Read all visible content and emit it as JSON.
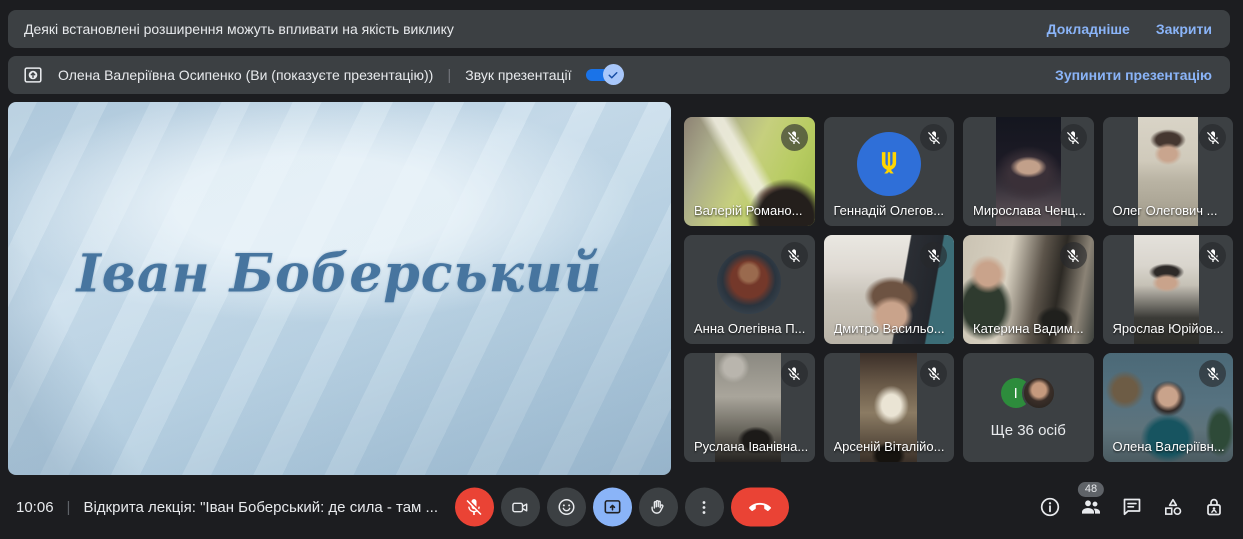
{
  "banner_extensions": {
    "message": "Деякі встановлені розширення можуть впливати на якість виклику",
    "details_label": "Докладніше",
    "close_label": "Закрити"
  },
  "banner_presentation": {
    "presenter": "Олена Валеріївна Осипенко (Ви (показуєте презентацію))",
    "sound_label": "Звук презентації",
    "sound_on": true,
    "stop_label": "Зупинити презентацію"
  },
  "presentation": {
    "slide_text": "Іван Боберський"
  },
  "participants": [
    {
      "name": "Валерій Романо...",
      "muted": true
    },
    {
      "name": "Геннадій Олегов...",
      "muted": true
    },
    {
      "name": "Мирослава Ченц...",
      "muted": true
    },
    {
      "name": "Олег Олегович ...",
      "muted": true
    },
    {
      "name": "Анна Олегівна П...",
      "muted": true
    },
    {
      "name": "Дмитро Васильо...",
      "muted": true
    },
    {
      "name": "Катерина Вадим...",
      "muted": true
    },
    {
      "name": "Ярослав Юрійов...",
      "muted": true
    },
    {
      "name": "Руслана Іванівна...",
      "muted": true
    },
    {
      "name": "Арсеній Віталійо...",
      "muted": true
    },
    {
      "name": "Ще 36 осіб",
      "overflow": true,
      "overflow_initial": "І"
    },
    {
      "name": "Олена Валеріївн...",
      "muted": true
    }
  ],
  "toolbar": {
    "time": "10:06",
    "meeting_title": "Відкрита лекція: \"Іван Боберський: де сила - там ...",
    "controls": [
      "mic-off",
      "camera",
      "reactions",
      "present-screen",
      "raise-hand",
      "more-options",
      "end-call"
    ],
    "right_icons": [
      "info",
      "people",
      "chat",
      "activities",
      "host-controls"
    ],
    "participants_count": "48"
  },
  "colors": {
    "background": "#202124",
    "surface": "#3c4043",
    "accent_blue": "#8ab4f8",
    "danger_red": "#ea4335",
    "toggle_blue": "#1a73e8",
    "slide_text": "#47759f"
  }
}
